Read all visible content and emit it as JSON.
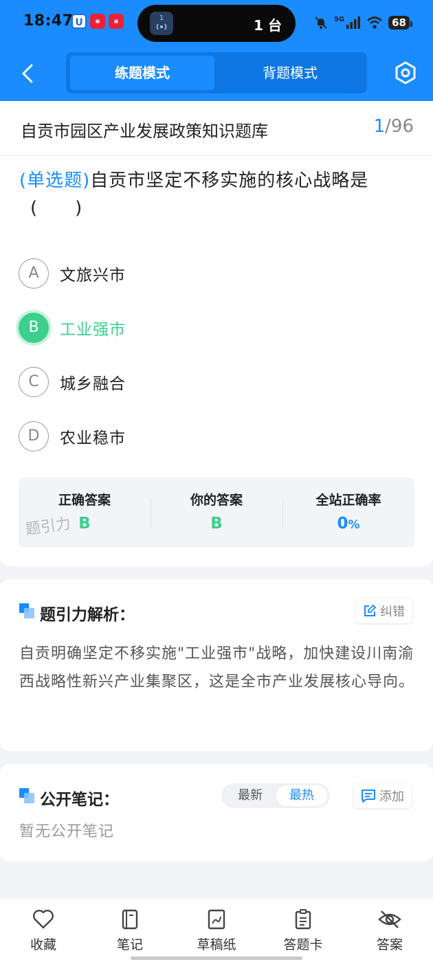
{
  "status": {
    "time": "18:47",
    "island_text": "1 台",
    "island_badge": "1",
    "network": "5G",
    "battery": "68"
  },
  "header": {
    "tabs": [
      {
        "label": "练题模式",
        "active": true
      },
      {
        "label": "背题模式",
        "active": false
      }
    ]
  },
  "question": {
    "bank_title": "自贡市园区产业发展政策知识题库",
    "current": "1",
    "total_sep": "/96",
    "type_label": "(单选题)",
    "text": "自贡市坚定不移实施的核心战略是",
    "paren": "(　　)",
    "options": [
      {
        "letter": "A",
        "label": "文旅兴市",
        "correct": false
      },
      {
        "letter": "B",
        "label": "工业强市",
        "correct": true
      },
      {
        "letter": "C",
        "label": "城乡融合",
        "correct": false
      },
      {
        "letter": "D",
        "label": "农业稳市",
        "correct": false
      }
    ]
  },
  "answers": {
    "correct_label": "正确答案",
    "correct_value": "B",
    "yours_label": "你的答案",
    "yours_value": "B",
    "rate_label": "全站正确率",
    "rate_value": "0",
    "rate_unit": "%",
    "watermark": "题引力"
  },
  "analysis": {
    "title": "题引力解析：",
    "correct_btn": "纠错",
    "text": "自贡明确坚定不移实施\"工业强市\"战略，加快建设川南渝西战略性新兴产业集聚区，这是全市产业发展核心导向。"
  },
  "notes": {
    "title": "公开笔记：",
    "sort_latest": "最新",
    "sort_hot": "最热",
    "add_btn": "添加",
    "empty": "暂无公开笔记"
  },
  "bottom_nav": [
    {
      "label": "收藏",
      "icon": "heart-icon"
    },
    {
      "label": "笔记",
      "icon": "notebook-icon"
    },
    {
      "label": "草稿纸",
      "icon": "draft-icon"
    },
    {
      "label": "答题卡",
      "icon": "answer-sheet-icon"
    },
    {
      "label": "答案",
      "icon": "eye-hidden-icon"
    }
  ],
  "colors": {
    "brand": "#1a8cff",
    "correct": "#3ccf8e"
  }
}
